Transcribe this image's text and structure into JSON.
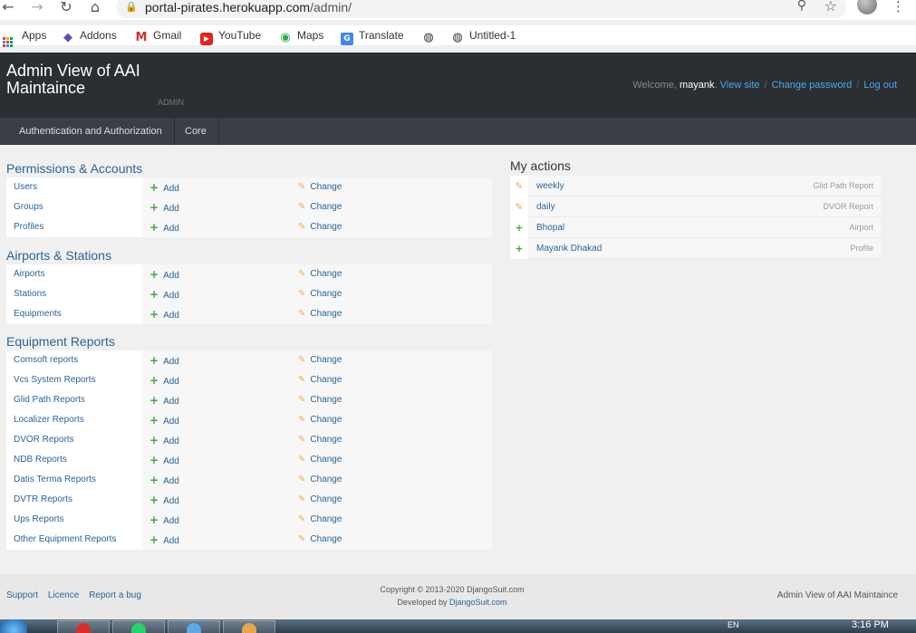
{
  "browser": {
    "url_host": "portal-pirates.herokuapp.com",
    "url_path": "/admin/",
    "bookmarks": [
      {
        "label": "Apps",
        "icon": "apps-grid-icon"
      },
      {
        "label": "Addons",
        "icon": "addons-icon"
      },
      {
        "label": "Gmail",
        "icon": "gmail-icon"
      },
      {
        "label": "YouTube",
        "icon": "youtube-icon"
      },
      {
        "label": "Maps",
        "icon": "maps-icon"
      },
      {
        "label": "Translate",
        "icon": "translate-icon"
      },
      {
        "label": "",
        "icon": "globe-icon"
      },
      {
        "label": "Untitled-1",
        "icon": "globe-icon"
      }
    ]
  },
  "header": {
    "title": "Admin View of AAI Maintaince",
    "subtitle": "ADMIN",
    "welcome": "Welcome,",
    "username": "mayank",
    "links": [
      "View site",
      "Change password",
      "Log out"
    ],
    "separator": "/"
  },
  "nav": [
    "Authentication and Authorization",
    "Core"
  ],
  "row_actions": {
    "add": "Add",
    "change": "Change"
  },
  "modules": [
    {
      "title": "Permissions & Accounts",
      "rows": [
        "Users",
        "Groups",
        "Profiles"
      ]
    },
    {
      "title": "Airports & Stations",
      "rows": [
        "Airports",
        "Stations",
        "Equipments"
      ]
    },
    {
      "title": "Equipment Reports",
      "rows": [
        "Comsoft reports",
        "Vcs System Reports",
        "Glid Path Reports",
        "Localizer Reports",
        "DVOR Reports",
        "NDB Reports",
        "Datis Terma Reports",
        "DVTR Reports",
        "Ups Reports",
        "Other Equipment Reports"
      ]
    }
  ],
  "my_actions": {
    "title": "My actions",
    "items": [
      {
        "kind": "edit",
        "object": "weekly",
        "type": "Glid Path Report"
      },
      {
        "kind": "edit",
        "object": "daily",
        "type": "DVOR Report"
      },
      {
        "kind": "addition",
        "object": "Bhopal",
        "type": "Airport"
      },
      {
        "kind": "addition",
        "object": "Mayank Dhakad",
        "type": "Profile"
      }
    ]
  },
  "footer": {
    "links": [
      "Support",
      "Licence",
      "Report a bug"
    ],
    "copyright": "Copyright © 2013-2020 DjangoSuit.com",
    "developed_by": "Developed by",
    "developer": "DjangoSuit.com",
    "brand": "Admin View of AAI Maintaince"
  },
  "taskbar": {
    "lang": "EN",
    "time": "3:16 PM"
  },
  "colors": {
    "header_bg": "#2b2e33",
    "nav_bg": "#3b3f45",
    "link": "#2a6496",
    "add_green": "#46a546",
    "change_orange": "#f0ad4e"
  }
}
